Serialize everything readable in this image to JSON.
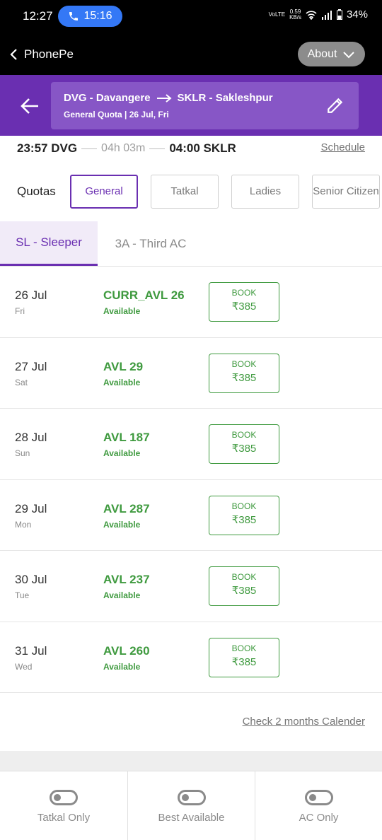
{
  "status_bar": {
    "time": "12:27",
    "call_duration": "15:16",
    "net_speed": "0.59",
    "net_unit": "KB/s",
    "battery": "34%",
    "volte": "VoLTE"
  },
  "app_bar": {
    "back_label": "PhonePe",
    "about_label": "About"
  },
  "journey": {
    "from": "DVG - Davangere",
    "to": "SKLR - Sakleshpur",
    "subtitle": "General Quota | 26 Jul, Fri"
  },
  "timing": {
    "depart": "23:57 DVG",
    "duration": "04h 03m",
    "arrive": "04:00 SKLR",
    "schedule_link": "Schedule"
  },
  "quotas": {
    "label": "Quotas",
    "options": [
      "General",
      "Tatkal",
      "Ladies",
      "Senior Citizen"
    ],
    "selected": "General"
  },
  "class_tabs": {
    "tabs": [
      "SL - Sleeper",
      "3A - Third AC"
    ],
    "selected": "SL - Sleeper"
  },
  "availability": [
    {
      "date": "26 Jul",
      "day": "Fri",
      "status": "CURR_AVL 26",
      "sub": "Available",
      "book": "BOOK",
      "price": "₹385"
    },
    {
      "date": "27 Jul",
      "day": "Sat",
      "status": "AVL 29",
      "sub": "Available",
      "book": "BOOK",
      "price": "₹385"
    },
    {
      "date": "28 Jul",
      "day": "Sun",
      "status": "AVL 187",
      "sub": "Available",
      "book": "BOOK",
      "price": "₹385"
    },
    {
      "date": "29 Jul",
      "day": "Mon",
      "status": "AVL 287",
      "sub": "Available",
      "book": "BOOK",
      "price": "₹385"
    },
    {
      "date": "30 Jul",
      "day": "Tue",
      "status": "AVL 237",
      "sub": "Available",
      "book": "BOOK",
      "price": "₹385"
    },
    {
      "date": "31 Jul",
      "day": "Wed",
      "status": "AVL 260",
      "sub": "Available",
      "book": "BOOK",
      "price": "₹385"
    }
  ],
  "calendar_link": "Check 2 months Calender",
  "filters": [
    {
      "label": "Tatkal Only",
      "on": false
    },
    {
      "label": "Best Available",
      "on": false
    },
    {
      "label": "AC Only",
      "on": false
    }
  ],
  "colors": {
    "brand": "#6a2fb1",
    "available": "#3f9a3f",
    "call_pill": "#3478f6"
  }
}
